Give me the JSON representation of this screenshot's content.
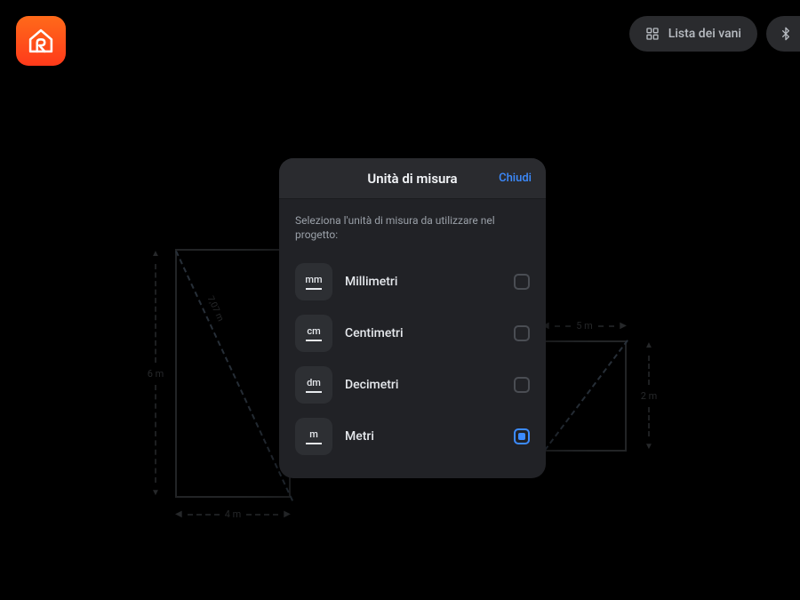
{
  "topbar": {
    "rooms_button": "Lista dei vani"
  },
  "modal": {
    "title": "Unità di misura",
    "close": "Chiudi",
    "description": "Seleziona l'unità di misura da utilizzare nel progetto:",
    "options": [
      {
        "abbr": "mm",
        "label": "Millimetri",
        "selected": false
      },
      {
        "abbr": "cm",
        "label": "Centimetri",
        "selected": false
      },
      {
        "abbr": "dm",
        "label": "Decimetri",
        "selected": false
      },
      {
        "abbr": "m",
        "label": "Metri",
        "selected": true
      }
    ]
  },
  "canvas": {
    "room_left": {
      "height_label": "6 m",
      "width_label": "4 m",
      "diag_label": "7,07 m"
    },
    "room_right": {
      "width_label": "5 m",
      "height_label": "2 m"
    }
  },
  "colors": {
    "accent": "#3c8bff",
    "logo_top": "#ff6a1a",
    "logo_bottom": "#ff3a1a"
  }
}
